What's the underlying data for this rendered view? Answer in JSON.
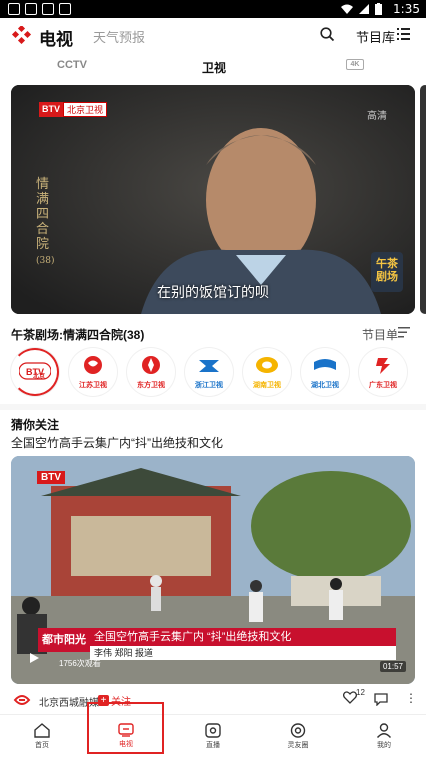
{
  "status_bar": {
    "time": "1:35"
  },
  "header": {
    "app_title": "电视",
    "weather_label": "天气预报",
    "guide_label": "节目库"
  },
  "tabs": [
    {
      "label": "CCTV",
      "active": false
    },
    {
      "label": "卫视",
      "active": true
    },
    {
      "label": "4K",
      "active": false
    }
  ],
  "player": {
    "channel_badge": "BTV",
    "channel_name": "北京卫视",
    "quality": "高清",
    "vertical_title": "情满四合院",
    "episode": "(38)",
    "subtitle": "在别的饭馆订的呗",
    "corner_mark": "午茶剧场"
  },
  "now_playing": {
    "title": "午茶剧场:情满四合院(38)",
    "guide_label": "节目单"
  },
  "channels": [
    {
      "name": "北京",
      "color": "#d8191a",
      "active": true
    },
    {
      "name": "江苏卫视",
      "color": "#e02323"
    },
    {
      "name": "东方卫视",
      "color": "#e02323"
    },
    {
      "name": "浙江卫视",
      "color": "#1a73c9"
    },
    {
      "name": "湖南卫视",
      "color": "#f5b400"
    },
    {
      "name": "湖北卫视",
      "color": "#1a73c9"
    },
    {
      "name": "广东卫视",
      "color": "#e02323"
    }
  ],
  "recommend": {
    "section_title": "猜你关注",
    "headline": "全国空竹高手云集广内“抖”出绝技和文化",
    "video": {
      "badge": "BTV",
      "program_tag": "都市阳光",
      "lower_third_title": "全国空竹高手云集广内 “抖”出绝技和文化",
      "lower_third_reporters": "李伟 郑阳 报道",
      "views": "1756次观看",
      "duration": "01:57"
    },
    "source": "北京西城融媒",
    "follow_label": "关注",
    "like_count": "12"
  },
  "bottom_nav": [
    {
      "label": "首页",
      "icon": "home-icon"
    },
    {
      "label": "电视",
      "icon": "tv-icon",
      "active": true
    },
    {
      "label": "直播",
      "icon": "live-icon"
    },
    {
      "label": "灵友圈",
      "icon": "circle-icon"
    },
    {
      "label": "我的",
      "icon": "profile-icon"
    }
  ],
  "colors": {
    "accent": "#e02323",
    "brand": "#d8191a"
  }
}
